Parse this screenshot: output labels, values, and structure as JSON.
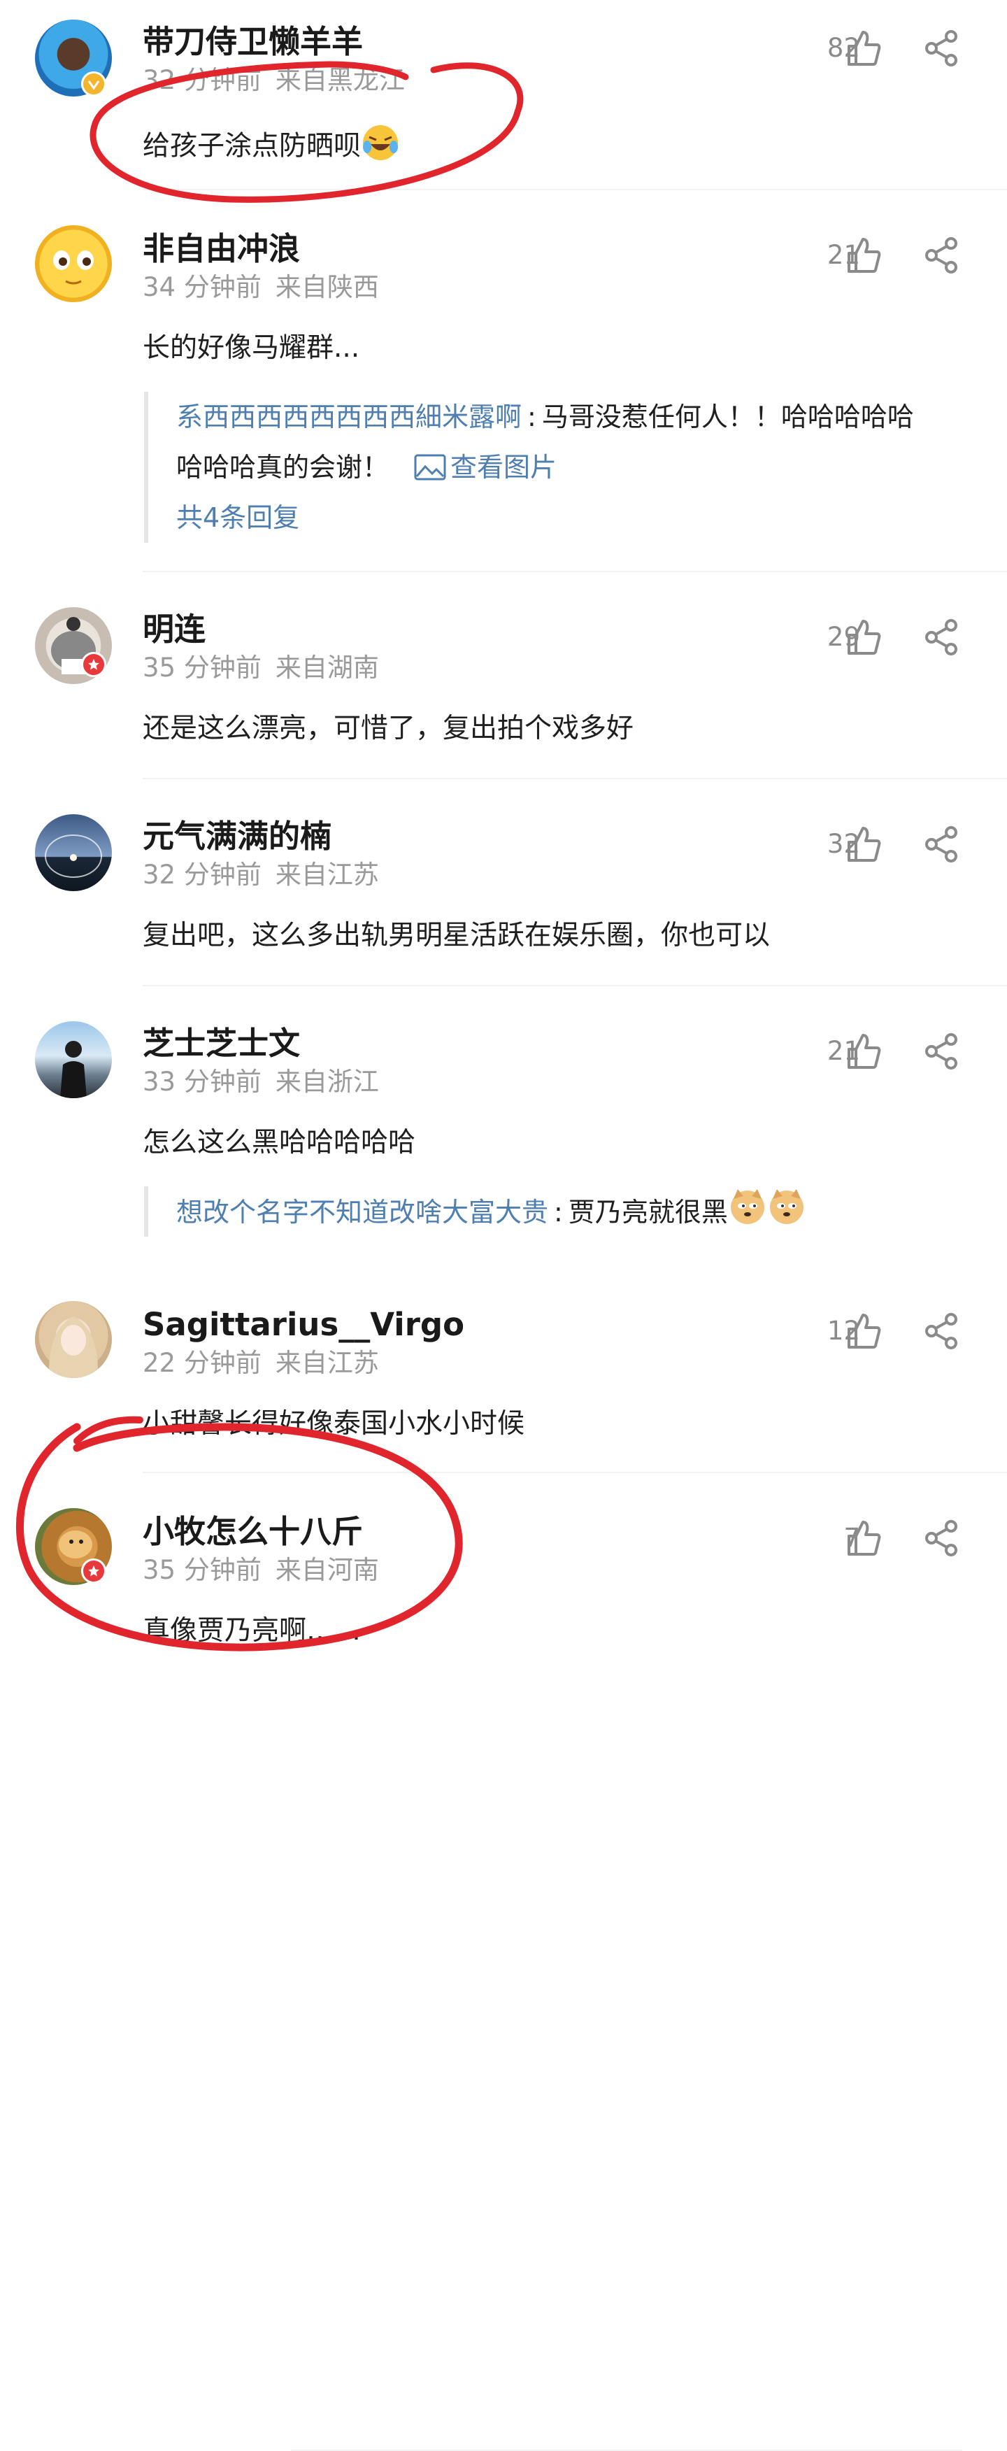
{
  "comments": [
    {
      "name": "带刀侍卫懒羊羊",
      "time": "32 分钟前",
      "location": "来自黑龙江",
      "text": "给孩子涂点防晒呗",
      "likes": "82"
    },
    {
      "name": "非自由冲浪",
      "time": "34 分钟前",
      "location": "来自陕西",
      "text": "长的好像马耀群...",
      "likes": "21",
      "reply": {
        "user": "系西西西西西西西西細米露啊",
        "sep": ":",
        "text1": "马哥没惹任何人！！哈哈哈哈哈",
        "text2": "哈哈哈真的会谢！",
        "view_image": "查看图片",
        "more": "共4条回复"
      }
    },
    {
      "name": "明连",
      "time": "35 分钟前",
      "location": "来自湖南",
      "text": "还是这么漂亮，可惜了，复出拍个戏多好",
      "likes": "29"
    },
    {
      "name": "元气满满的楠",
      "time": "32 分钟前",
      "location": "来自江苏",
      "text": "复出吧，这么多出轨男明星活跃在娱乐圈，你也可以",
      "likes": "32"
    },
    {
      "name": "芝士芝士文",
      "time": "33 分钟前",
      "location": "来自浙江",
      "text": "怎么这么黑哈哈哈哈哈",
      "likes": "21",
      "reply": {
        "user": "想改个名字不知道改啥大富大贵",
        "sep": ":",
        "text1": "贾乃亮就很黑"
      }
    },
    {
      "name": "Sagittarius__Virgo",
      "time": "22 分钟前",
      "location": "来自江苏",
      "text": "小甜馨长得好像泰国小水小时候",
      "likes": "12"
    },
    {
      "name": "小牧怎么十八斤",
      "time": "35 分钟前",
      "location": "来自河南",
      "text": "真像贾乃亮啊……",
      "likes": "7"
    }
  ],
  "icons": {
    "like": "thumbs-up-icon",
    "share": "share-icon",
    "image": "image-icon"
  },
  "colors": {
    "link": "#4e7fb0",
    "annotation": "#e0262c",
    "meta": "#9a9a9a"
  }
}
